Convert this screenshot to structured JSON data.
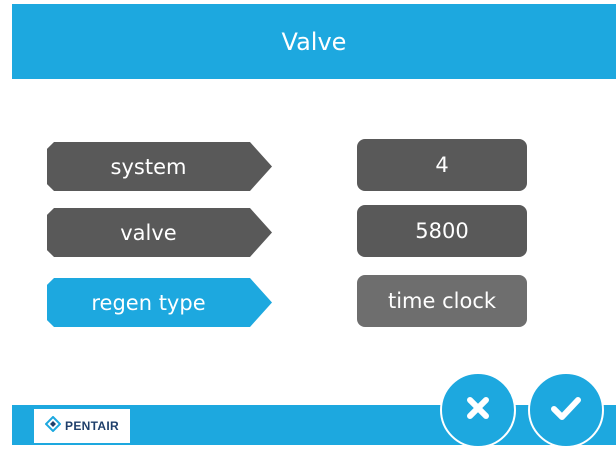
{
  "header": {
    "title": "Valve"
  },
  "settings": [
    {
      "label": "system",
      "value": "4"
    },
    {
      "label": "valve",
      "value": "5800"
    },
    {
      "label": "regen type",
      "value": "time clock"
    }
  ],
  "footer": {
    "logo_text": "PENTAIR"
  },
  "icons": {
    "cancel": "close-icon",
    "confirm": "check-icon",
    "logo": "pentair-diamond-icon"
  },
  "colors": {
    "accent": "#1da8df",
    "button_dark": "#595959",
    "button_value_light": "#6e6e6e",
    "logo_text": "#1f3f6b"
  }
}
